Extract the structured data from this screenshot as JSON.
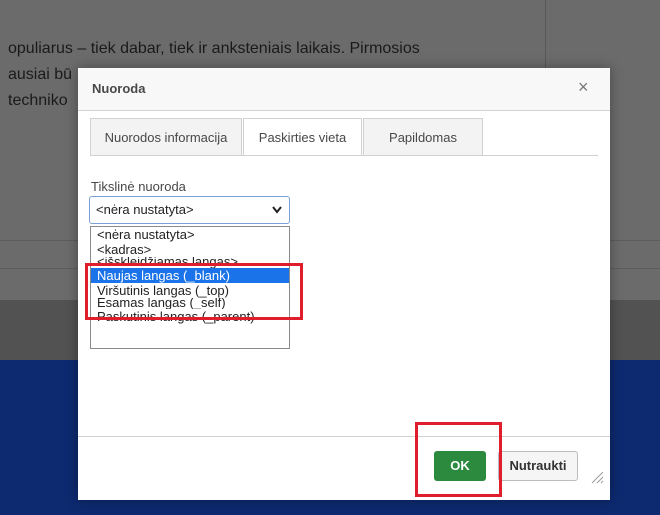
{
  "background": {
    "lines": [
      "opuliarus – tiek dabar, tiek ir anksteniais laikais. Pirmosios",
      "ausiai bū",
      "techniko"
    ]
  },
  "dialog": {
    "title": "Nuoroda",
    "close_glyph": "×",
    "tabs": [
      "Nuorodos informacija",
      "Paskirties vieta",
      "Papildomas"
    ],
    "active_tab": "Paskirties vieta",
    "target": {
      "label": "Tikslinė nuoroda",
      "selected_value": "<nėra nustatyta>",
      "arrow_glyph": "⌄",
      "options": [
        "<nėra nustatyta>",
        "<kadras>",
        "<išskleidžiamas langas>",
        "Naujas langas (_blank)",
        "Viršutinis langas (_top)",
        "Esamas langas (_self)",
        "Paskutinis langas (_parent)"
      ],
      "highlighted_option": "Naujas langas (_blank)"
    },
    "buttons": {
      "ok": "OK",
      "cancel": "Nutraukti"
    }
  },
  "colors": {
    "accent": "#2b8a3e",
    "highlight": "#e01e2b",
    "selection": "#1a73e8",
    "footer_band": "#0d2a70"
  }
}
